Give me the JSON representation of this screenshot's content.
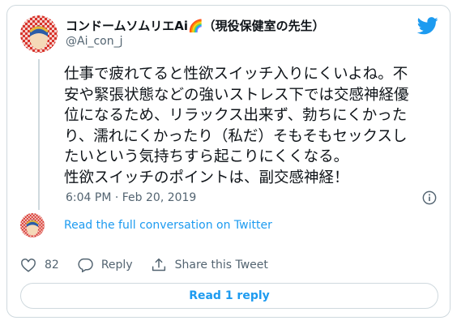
{
  "tweet": {
    "display_name": "コンドームソムリエAi🌈（現役保健室の先生）",
    "handle": "@Ai_con_j",
    "text": "仕事で疲れてると性欲スイッチ入りにくいよね。不\n安や緊張状態などの強いストレス下では交感神経優\n位になるため、リラックス出来ず、勃ちにくかった\nり、濡れにくかったり（私だ）そもそもセックスし\nたいという気持ちすら起こりにくくなる。\n性欲スイッチのポイントは、副交感神経！",
    "timestamp": "6:04 PM · Feb 20, 2019"
  },
  "conversation": {
    "read_full_label": "Read the full conversation on Twitter"
  },
  "actions": {
    "like_count": "82",
    "reply_label": "Reply",
    "share_label": "Share this Tweet"
  },
  "read_replies_label": "Read 1 reply",
  "colors": {
    "accent": "#1d9bf0",
    "muted": "#536471",
    "border": "#cfd9de"
  },
  "icons": [
    "twitter-bird-icon",
    "info-icon",
    "heart-icon",
    "reply-icon",
    "share-icon"
  ]
}
